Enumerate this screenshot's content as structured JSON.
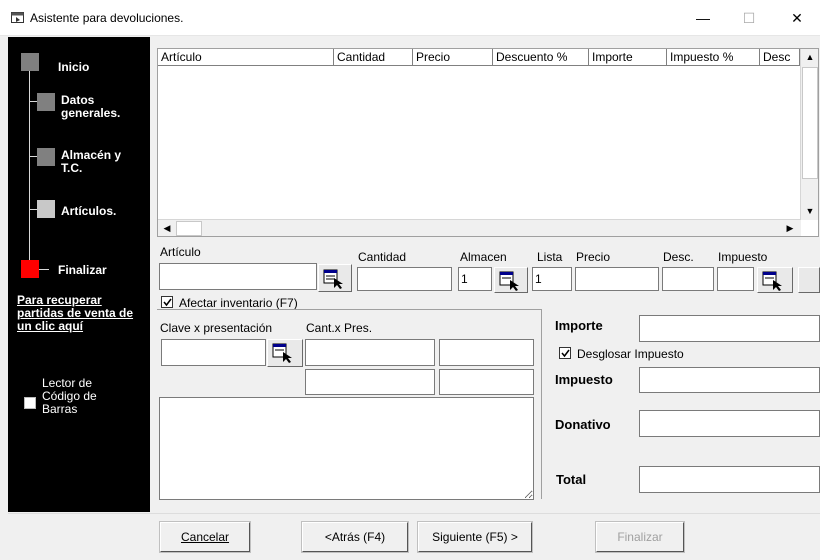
{
  "window": {
    "title": "Asistente para devoluciones.",
    "minimize": "—",
    "maximize": "☐",
    "close": "✕"
  },
  "steps": [
    {
      "label": "Inicio",
      "color": "#808080"
    },
    {
      "label": "Datos generales.",
      "color": "#808080"
    },
    {
      "label": "Almacén y T.C.",
      "color": "#808080"
    },
    {
      "label": "Artículos.",
      "color": "#c8c8c8"
    },
    {
      "label": "Finalizar",
      "color": "#ff0000"
    }
  ],
  "recover_link": "Para recuperar partidas de venta de un clic aquí",
  "barcode": {
    "label": "Lector de Código de Barras",
    "checked": false
  },
  "grid": {
    "columns": [
      "Artículo",
      "Cantidad",
      "Precio",
      "Descuento %",
      "Importe",
      "Impuesto %",
      "Desc"
    ],
    "rows": []
  },
  "form": {
    "articulo_label": "Artículo",
    "articulo_value": "",
    "cantidad_label": "Cantidad",
    "cantidad_value": "",
    "almacen_label": "Almacen",
    "almacen_value": "1",
    "lista_label": "Lista",
    "lista_value": "1",
    "precio_label": "Precio",
    "precio_value": "",
    "desc_label": "Desc.",
    "desc_value": "",
    "impuesto_label": "Impuesto",
    "impuesto_value": "",
    "afectar_label": "Afectar inventario (F7)",
    "afectar_checked": true,
    "clave_label": "Clave x presentación",
    "clave_value": "",
    "cantpres_label": "Cant.x Pres.",
    "notes_value": ""
  },
  "totals": {
    "importe_label": "Importe",
    "importe_value": "",
    "desglosar_label": "Desglosar Impuesto",
    "desglosar_checked": true,
    "impuesto_label": "Impuesto",
    "impuesto_value": "",
    "donativo_label": "Donativo",
    "donativo_value": "",
    "total_label": "Total",
    "total_value": ""
  },
  "buttons": {
    "cancelar": "Cancelar",
    "atras": "<Atrás (F4)",
    "siguiente": "Siguiente (F5) >",
    "finalizar": "Finalizar"
  }
}
